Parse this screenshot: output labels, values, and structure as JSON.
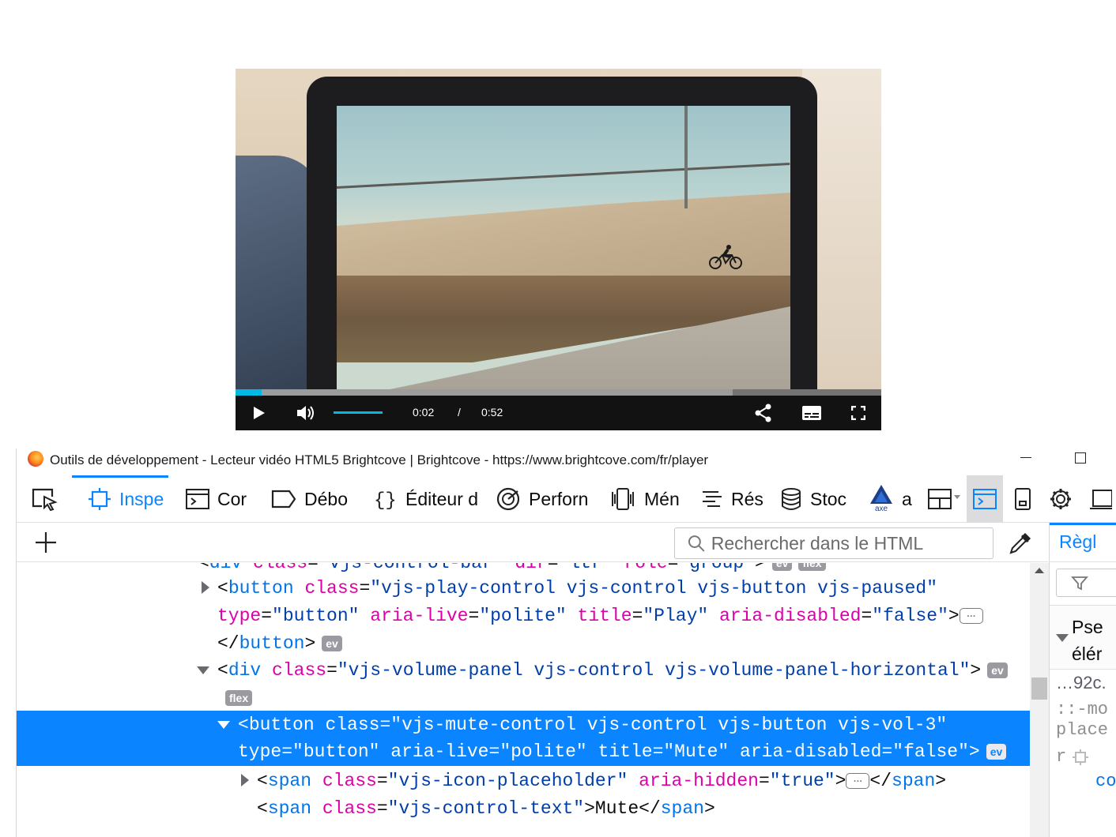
{
  "player": {
    "current_time": "0:02",
    "time_divider": "/",
    "duration": "0:52",
    "progress_fraction": 0.04,
    "buffered_fraction": 0.77,
    "volume_fraction": 1.0,
    "accent_color": "#00b9e5",
    "icons": [
      "play-icon",
      "volume-icon",
      "share-icon",
      "captions-icon",
      "fullscreen-icon"
    ]
  },
  "window": {
    "title": "Outils de développement - Lecteur vidéo HTML5 Brightcove | Brightcove - https://www.brightcove.com/fr/player"
  },
  "toolbar": {
    "tabs": [
      {
        "label": "Inspe",
        "icon": "inspector-icon"
      },
      {
        "label": "Cor",
        "icon": "console-icon"
      },
      {
        "label": "Débo",
        "icon": "debugger-icon"
      },
      {
        "label": "Éditeur d",
        "icon": "style-editor-icon"
      },
      {
        "label": "Perforn",
        "icon": "performance-icon"
      },
      {
        "label": "Mén",
        "icon": "memory-icon"
      },
      {
        "label": "Rés",
        "icon": "network-icon"
      },
      {
        "label": "Stoc",
        "icon": "storage-icon"
      },
      {
        "label": "a",
        "icon": "axe-icon"
      }
    ],
    "axe_logo_text": "axe",
    "active_color": "#0a84ff"
  },
  "search": {
    "placeholder": "Rechercher dans le HTML"
  },
  "markup": {
    "line0": {
      "prefix": "<",
      "tag": "div",
      "attr1": "class",
      "val1": "\"vjs-control-bar\"",
      "attr2": "dir",
      "val2": "\"ltr\"",
      "attr3": "role",
      "val3": "\"group\"",
      "suffix": ">",
      "badge1": "ev",
      "badge2": "flex"
    },
    "line1": {
      "prefix": "<",
      "tag": "button",
      "attr1": "class",
      "val1": "\"vjs-play-control vjs-control vjs-button vjs-paused\""
    },
    "line2": {
      "attr1": "type",
      "val1": "\"button\"",
      "attr2": "aria-live",
      "val2": "\"polite\"",
      "attr3": "title",
      "val3": "\"Play\"",
      "attr4": "aria-disabled",
      "val4": "\"false\"",
      "suffix": ">",
      "ellipsis": "…"
    },
    "line3": {
      "prefix": "</",
      "tag": "button",
      "suffix": ">",
      "badge": "ev"
    },
    "line4": {
      "prefix": "<",
      "tag": "div",
      "attr1": "class",
      "val1": "\"vjs-volume-panel vjs-control vjs-volume-panel-horizontal\"",
      "suffix": ">",
      "badge": "ev"
    },
    "line5": {
      "badge": "flex"
    },
    "line6": {
      "prefix": "<",
      "tag": "button",
      "attr1": "class",
      "val1": "\"vjs-mute-control vjs-control vjs-button vjs-vol-3\""
    },
    "line7": {
      "attr1": "type",
      "val1": "\"button\"",
      "attr2": "aria-live",
      "val2": "\"polite\"",
      "attr3": "title",
      "val3": "\"Mute\"",
      "attr4": "aria-disabled",
      "val4": "\"false\"",
      "suffix": ">",
      "badge": "ev"
    },
    "line8": {
      "prefix": "<",
      "tag": "span",
      "attr1": "class",
      "val1": "\"vjs-icon-placeholder\"",
      "attr2": "aria-hidden",
      "val2": "\"true\"",
      "mid": ">",
      "ellipsis": "…",
      "close_prefix": "</",
      "close_tag": "span",
      "suffix": ">"
    },
    "line9": {
      "prefix": "<",
      "tag": "span",
      "attr1": "class",
      "val1": "\"vjs-control-text\"",
      "text": ">Mute</",
      "close_tag": "span",
      "suffix": ">"
    },
    "selection_color": "#0a84ff"
  },
  "sidebar": {
    "tab_label": "Règl",
    "pseudo_label": "Pse\nélér",
    "selector": "…92c.",
    "pseudo1": "::-mo",
    "pseudo2": "place",
    "pseudo3": "r",
    "prop": "co"
  }
}
